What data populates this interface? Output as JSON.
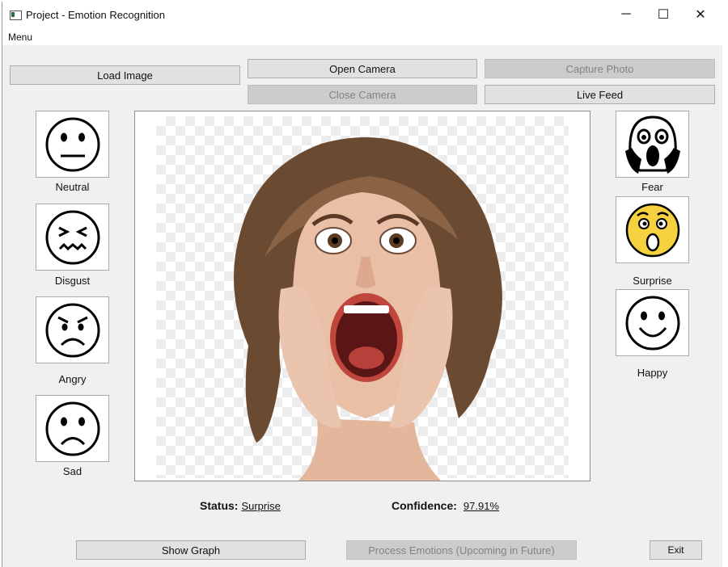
{
  "window": {
    "title": "Project - Emotion Recognition",
    "minimize": "─",
    "maximize": "☐",
    "close": "✕"
  },
  "menubar": {
    "menu": "Menu"
  },
  "toolbar": {
    "load_image": "Load Image",
    "open_camera": "Open Camera",
    "capture_photo": "Capture Photo",
    "close_camera": "Close Camera",
    "live_feed": "Live Feed"
  },
  "left_emotions": [
    {
      "label": "Neutral",
      "icon": "neutral-face-icon"
    },
    {
      "label": "Disgust",
      "icon": "disgust-face-icon"
    },
    {
      "label": "Angry",
      "icon": "angry-face-icon"
    },
    {
      "label": "Sad",
      "icon": "sad-face-icon"
    }
  ],
  "right_emotions": [
    {
      "label": "Fear",
      "icon": "fear-face-icon"
    },
    {
      "label": "Surprise",
      "icon": "surprise-face-icon",
      "color": "#f5d03f"
    },
    {
      "label": "Happy",
      "icon": "happy-face-icon"
    }
  ],
  "image": {
    "subject": "surprised-woman-photo"
  },
  "result": {
    "status_label": "Status:",
    "status_value": "Surprise",
    "confidence_label": "Confidence:",
    "confidence_value": "97.91%"
  },
  "footer": {
    "show_graph": "Show Graph",
    "process_emotions": "Process Emotions (Upcoming in Future)",
    "exit": "Exit"
  }
}
